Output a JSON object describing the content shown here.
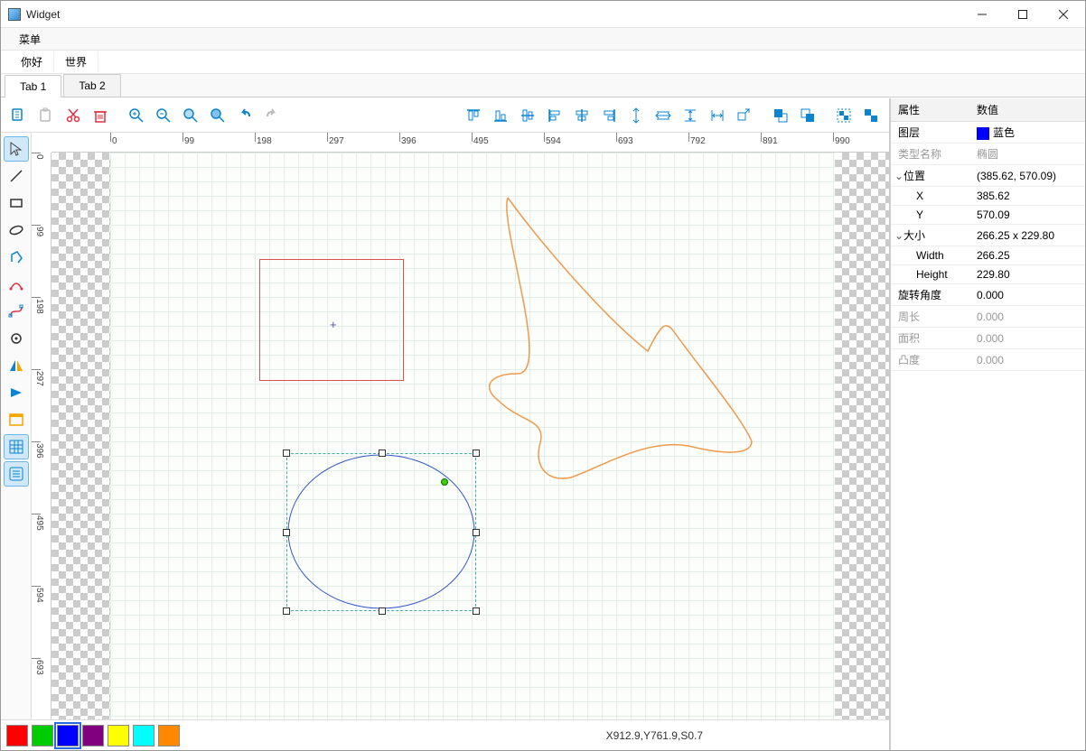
{
  "window": {
    "title": "Widget"
  },
  "menu": {
    "main": "菜单"
  },
  "menu2": {
    "hello": "你好",
    "world": "世界"
  },
  "tabs": {
    "t1": "Tab 1",
    "t2": "Tab 2"
  },
  "ruler": {
    "h": [
      "0",
      "99",
      "198",
      "297",
      "396",
      "495",
      "594",
      "693",
      "792",
      "891",
      "990"
    ],
    "v": [
      "0",
      "99",
      "198",
      "297",
      "396",
      "495",
      "594",
      "693"
    ]
  },
  "colors": [
    "#ff0000",
    "#00cc00",
    "#0000ff",
    "#800080",
    "#ffff00",
    "#00ffff",
    "#ff8800"
  ],
  "selected_color_index": 2,
  "status": "X912.9,Y761.9,S0.7",
  "props": {
    "header_attr": "属性",
    "header_val": "数值",
    "layer_label": "图层",
    "layer_value": "蓝色",
    "typename_label": "类型名称",
    "typename_value": "椭圆",
    "position_label": "位置",
    "position_value": "(385.62, 570.09)",
    "x_label": "X",
    "x_value": "385.62",
    "y_label": "Y",
    "y_value": "570.09",
    "size_label": "大小",
    "size_value": "266.25 x 229.80",
    "width_label": "Width",
    "width_value": "266.25",
    "height_label": "Height",
    "height_value": "229.80",
    "rotation_label": "旋转角度",
    "rotation_value": "0.000",
    "perimeter_label": "周长",
    "perimeter_value": "0.000",
    "area_label": "面积",
    "area_value": "0.000",
    "convexity_label": "凸度",
    "convexity_value": "0.000"
  }
}
